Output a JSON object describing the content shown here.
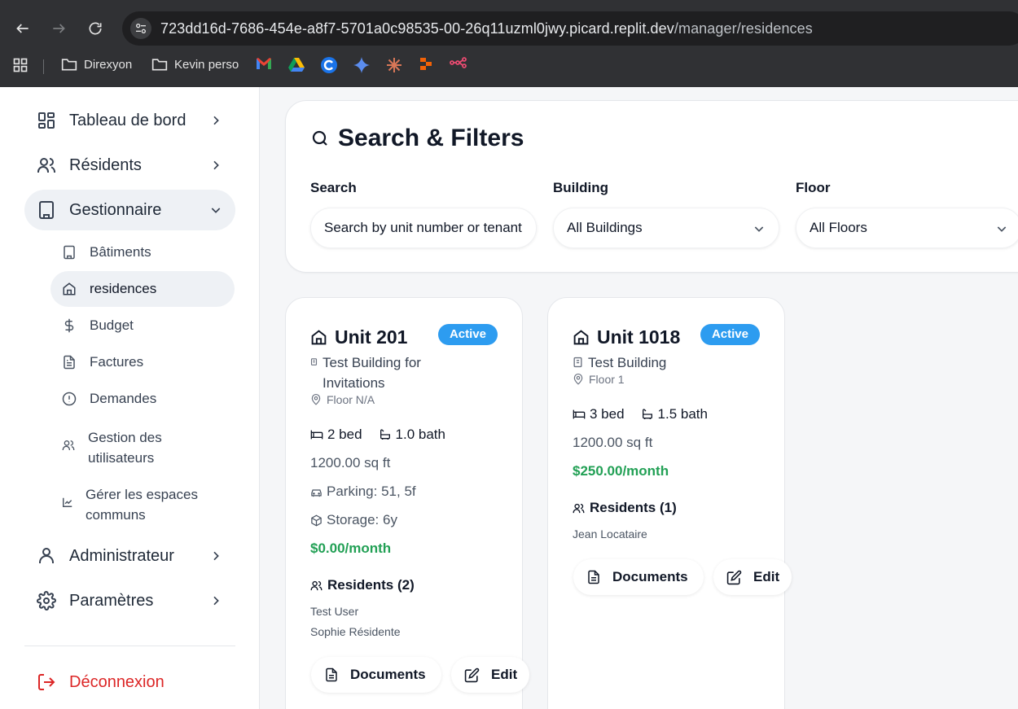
{
  "browser": {
    "url_host": "723dd16d-7686-454e-a8f7-5701a0c98535-00-26q11uzml0jwy.picard.replit.dev",
    "url_path": "/manager/residences",
    "bookmarks": [
      {
        "label": "Direxyon",
        "icon": "folder-icon"
      },
      {
        "label": "Kevin perso",
        "icon": "folder-icon"
      }
    ],
    "bookmark_icons": [
      "gmail-icon",
      "google-drive-icon",
      "c-app-icon",
      "gemini-icon",
      "claude-icon",
      "replit-icon",
      "n8n-icon"
    ]
  },
  "sidebar": {
    "items": [
      {
        "label": "Tableau de bord",
        "icon": "dashboard-icon"
      },
      {
        "label": "Résidents",
        "icon": "users-icon"
      },
      {
        "label": "Gestionnaire",
        "icon": "building-icon"
      }
    ],
    "sub_items": [
      {
        "label": "Bâtiments",
        "icon": "building-icon"
      },
      {
        "label": "residences",
        "icon": "home-icon"
      },
      {
        "label": "Budget",
        "icon": "dollar-icon"
      },
      {
        "label": "Factures",
        "icon": "file-icon"
      },
      {
        "label": "Demandes",
        "icon": "alert-circle-icon"
      },
      {
        "label": "Gestion des utilisateurs",
        "icon": "users-icon"
      },
      {
        "label": "Gérer les espaces communs",
        "icon": "chart-icon"
      }
    ],
    "items_bottom": [
      {
        "label": "Administrateur",
        "icon": "user-icon"
      },
      {
        "label": "Paramètres",
        "icon": "gear-icon"
      }
    ],
    "logout": "Déconnexion"
  },
  "filters": {
    "title": "Search & Filters",
    "search_label": "Search",
    "search_placeholder": "Search by unit number or tenant",
    "building_label": "Building",
    "building_value": "All Buildings",
    "floor_label": "Floor",
    "floor_value": "All Floors"
  },
  "residences": [
    {
      "unit": "Unit 201",
      "status": "Active",
      "building_line1": "Test Building for",
      "building_line2": "Invitations",
      "floor": "Floor N/A",
      "bed": "2 bed",
      "bath": "1.0 bath",
      "area": "1200.00 sq ft",
      "parking": "Parking: 51, 5f",
      "storage": "Storage: 6y",
      "price": "$0.00/month",
      "residents_title": "Residents (2)",
      "residents": [
        "Test User",
        "Sophie Résidente"
      ],
      "documents": "Documents",
      "edit": "Edit"
    },
    {
      "unit": "Unit 1018",
      "status": "Active",
      "building_line1": "Test Building",
      "floor": "Floor 1",
      "bed": "3 bed",
      "bath": "1.5 bath",
      "area": "1200.00 sq ft",
      "price": "$250.00/month",
      "residents_title": "Residents (1)",
      "residents": [
        "Jean Locataire"
      ],
      "documents": "Documents",
      "edit": "Edit"
    }
  ],
  "colors": {
    "accent": "#2d9cf0",
    "price": "#22a055",
    "logout": "#dc2626"
  }
}
